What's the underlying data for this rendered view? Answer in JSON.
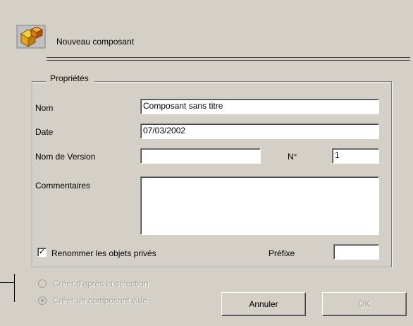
{
  "dialog": {
    "title": "Nouveau composant",
    "icon": "cube-component-icon"
  },
  "group": {
    "legend": "Propriétés"
  },
  "fields": {
    "nom_label": "Nom",
    "nom_value": "Composant sans titre",
    "date_label": "Date",
    "date_value": "07/03/2002",
    "version_label": "Nom de Version",
    "version_value": "",
    "numero_label": "N°",
    "numero_value": "1",
    "commentaires_label": "Commentaires",
    "commentaires_value": ""
  },
  "rename": {
    "label": "Renommer les objets privés",
    "checked": true,
    "prefix_label": "Préfixe",
    "prefix_value": ""
  },
  "options": {
    "from_selection": "Créer d'après la sélection",
    "empty_component": "Créer un composant vide",
    "selected": "empty_component",
    "enabled": false
  },
  "buttons": {
    "cancel": "Annuler",
    "ok": "OK",
    "ok_enabled": false
  }
}
